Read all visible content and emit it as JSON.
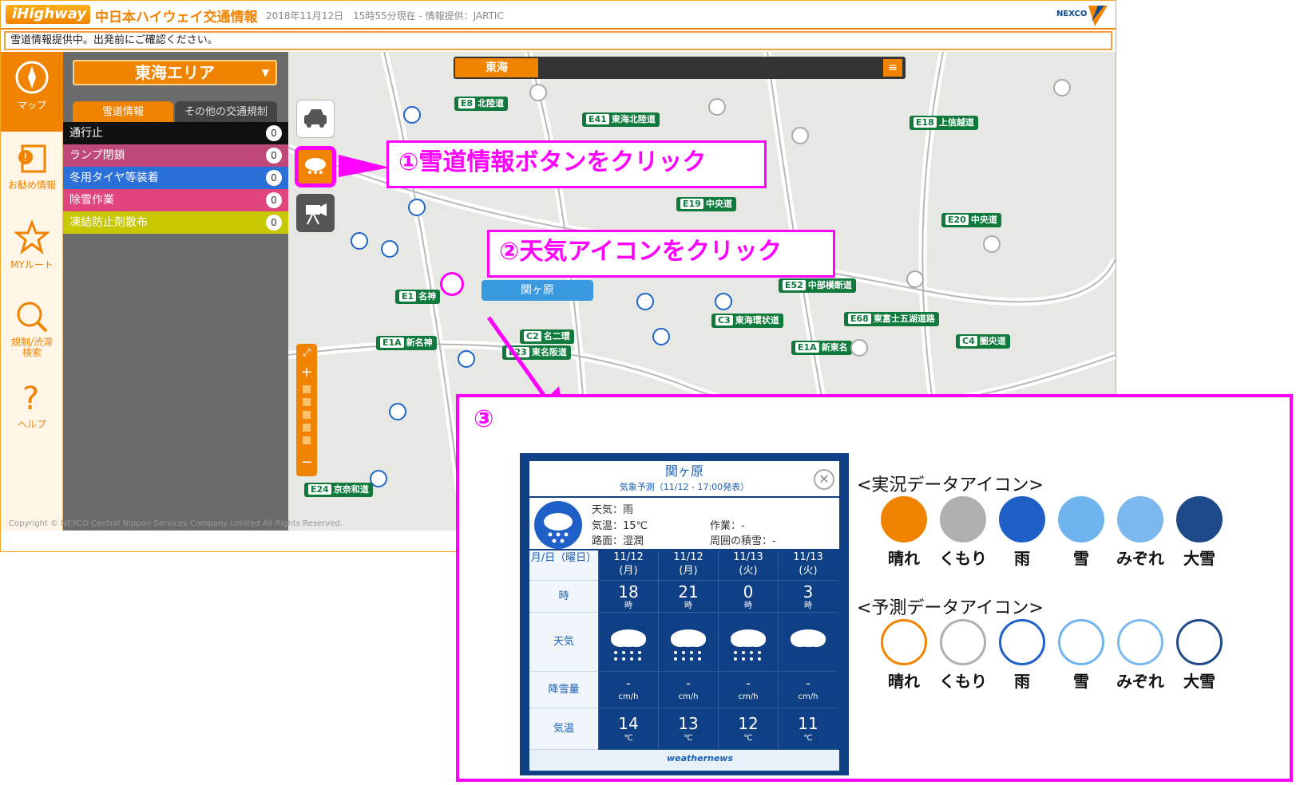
{
  "header": {
    "logo_text": "iHighway",
    "site_title": "中日本ハイウェイ交通情報",
    "datetime": "2018年11月12日　15時55分現在 - 情報提供：JARTIC",
    "brand": "NEXCO"
  },
  "notice": "雪道情報提供中。出発前にご確認ください。",
  "nav": [
    {
      "label": "マップ",
      "icon": "compass-icon"
    },
    {
      "label": "お勧め情報",
      "icon": "info-icon"
    },
    {
      "label": "MYルート",
      "icon": "star-icon"
    },
    {
      "label": "規制/渋滞検索",
      "icon": "search-icon"
    },
    {
      "label": "ヘルプ",
      "icon": "help-icon"
    }
  ],
  "side": {
    "area": "東海エリア",
    "tabs": [
      "雪道情報",
      "その他の交通規制"
    ],
    "rows": [
      {
        "label": "通行止",
        "count": "0",
        "color": "#111111"
      },
      {
        "label": "ランプ閉鎖",
        "count": "0",
        "color": "#c0477a"
      },
      {
        "label": "冬用タイヤ等装着",
        "count": "0",
        "color": "#2a70d8"
      },
      {
        "label": "除雪作業",
        "count": "0",
        "color": "#e0457e"
      },
      {
        "label": "凍結防止剤散布",
        "count": "0",
        "color": "#c8c800"
      }
    ]
  },
  "map": {
    "region": "東海",
    "popup": "関ヶ原",
    "roads": [
      {
        "code": "E8",
        "name": "北陸道"
      },
      {
        "code": "E41",
        "name": "東海北陸道"
      },
      {
        "code": "E18",
        "name": "上信越道"
      },
      {
        "code": "E19",
        "name": "中央道"
      },
      {
        "code": "E20",
        "name": "中央道"
      },
      {
        "code": "E1",
        "name": "名神"
      },
      {
        "code": "E52",
        "name": "中部横断道"
      },
      {
        "code": "C3",
        "name": "東海環状道"
      },
      {
        "code": "E68",
        "name": "東富士五湖道路"
      },
      {
        "code": "E1A",
        "name": "新名神"
      },
      {
        "code": "E1A",
        "name": "新東名"
      },
      {
        "code": "C4",
        "name": "圏央道"
      },
      {
        "code": "C2",
        "name": "名二環"
      },
      {
        "code": "E23",
        "name": "東名阪道"
      },
      {
        "code": "E24",
        "name": "京奈和道"
      }
    ]
  },
  "copyright": "Copyright © NEXCO Central Nippon Services Company Limited All Rights Reserved.",
  "callouts": {
    "step1": "①雪道情報ボタンをクリック",
    "step2": "②天気アイコンをクリック",
    "step3": "③"
  },
  "weather_popup": {
    "title": "関ヶ原",
    "subtitle": "気象予測（11/12 - 17:00発表）",
    "now": {
      "weather": "天気：雨",
      "temp": "気温：15℃",
      "road": "路面：湿潤",
      "work": "作業：-",
      "snow_around": "周囲の積雪：-"
    },
    "row_labels": {
      "date": "月/日（曜日）",
      "hour": "時",
      "weather": "天気",
      "snowfall": "降雪量",
      "temp": "気温"
    },
    "forecast": [
      {
        "date": "11/12",
        "dow": "(月)",
        "hour": "18",
        "weather": "rain",
        "snow": "-",
        "temp": "14"
      },
      {
        "date": "11/12",
        "dow": "(月)",
        "hour": "21",
        "weather": "rain",
        "snow": "-",
        "temp": "13"
      },
      {
        "date": "11/13",
        "dow": "(火)",
        "hour": "0",
        "weather": "rain",
        "snow": "-",
        "temp": "12"
      },
      {
        "date": "11/13",
        "dow": "(火)",
        "hour": "3",
        "weather": "cloud",
        "snow": "-",
        "temp": "11"
      }
    ],
    "units": {
      "hour": "時",
      "snow": "cm/h",
      "temp": "℃"
    },
    "provider": "weathernews"
  },
  "legend": {
    "actual_title": "<実況データアイコン>",
    "forecast_title": "<予測データアイコン>",
    "items": [
      {
        "label": "晴れ",
        "color": "#f08300"
      },
      {
        "label": "くもり",
        "color": "#b0b0b0"
      },
      {
        "label": "雨",
        "color": "#1e5fc8"
      },
      {
        "label": "雪",
        "color": "#6fb4ee"
      },
      {
        "label": "みぞれ",
        "color": "#7ab8ee"
      },
      {
        "label": "大雪",
        "color": "#1e4a8a"
      }
    ]
  }
}
